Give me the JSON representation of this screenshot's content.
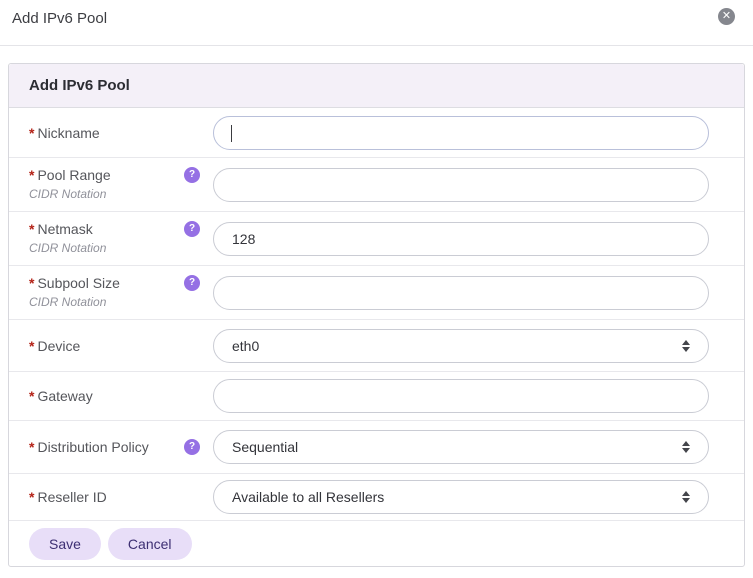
{
  "modal": {
    "title": "Add IPv6 Pool",
    "close_icon_glyph": "✕"
  },
  "form": {
    "title": "Add IPv6 Pool",
    "required_marker": "*",
    "help_icon_glyph": "?",
    "rows": [
      {
        "label": "Nickname",
        "control": "text",
        "value": "",
        "placeholder": ""
      },
      {
        "label": "Pool Range",
        "sublabel": "CIDR Notation",
        "has_help": true,
        "control": "text",
        "value": "",
        "placeholder": ""
      },
      {
        "label": "Netmask",
        "sublabel": "CIDR Notation",
        "has_help": true,
        "control": "text",
        "value": "128",
        "placeholder": ""
      },
      {
        "label": "Subpool Size",
        "sublabel": "CIDR Notation",
        "has_help": true,
        "control": "text",
        "value": "",
        "placeholder": ""
      },
      {
        "label": "Device",
        "control": "select",
        "value": "eth0"
      },
      {
        "label": "Gateway",
        "control": "text",
        "value": "",
        "placeholder": ""
      },
      {
        "label": "Distribution Policy",
        "has_help": true,
        "control": "select",
        "value": "Sequential"
      },
      {
        "label": "Reseller ID",
        "control": "select",
        "value": "Available to all Resellers"
      }
    ],
    "buttons": {
      "save": "Save",
      "cancel": "Cancel"
    }
  },
  "colors": {
    "accent_purple": "#9570e4",
    "button_bg": "#e8def8",
    "button_text": "#3d2f73",
    "required_red": "#b42318",
    "card_header_bg": "#f4f0f8"
  }
}
